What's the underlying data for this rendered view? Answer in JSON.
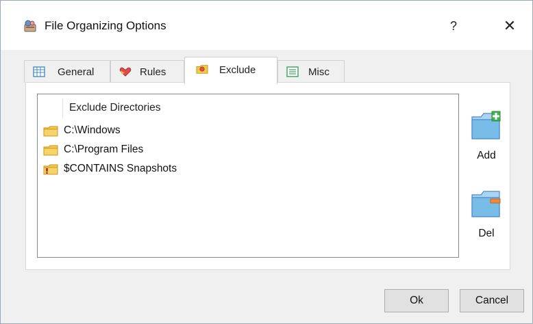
{
  "window": {
    "title": "File Organizing Options",
    "help_label": "?",
    "close_label": "✕"
  },
  "tabs": [
    {
      "label": "General",
      "icon": "general-grid-icon",
      "active": false
    },
    {
      "label": "Rules",
      "icon": "rules-heart-icon",
      "active": false
    },
    {
      "label": "Exclude",
      "icon": "exclude-folder-icon",
      "active": true
    },
    {
      "label": "Misc",
      "icon": "misc-list-icon",
      "active": false
    }
  ],
  "exclude_list": {
    "header": "Exclude Directories",
    "items": [
      {
        "label": "C:\\Windows",
        "icon": "folder-icon"
      },
      {
        "label": "C:\\Program Files",
        "icon": "folder-icon"
      },
      {
        "label": "$CONTAINS Snapshots",
        "icon": "folder-warning-icon"
      }
    ]
  },
  "side_buttons": {
    "add_label": "Add",
    "del_label": "Del"
  },
  "footer": {
    "ok_label": "Ok",
    "cancel_label": "Cancel"
  },
  "colors": {
    "folder_yellow": "#f2c94c",
    "add_green": "#3fb24b",
    "del_orange": "#f0883a",
    "big_folder_blue": "#6fb6e4"
  }
}
